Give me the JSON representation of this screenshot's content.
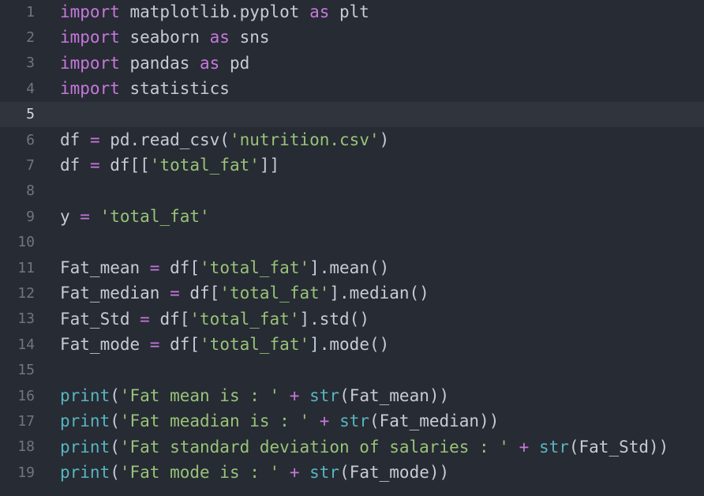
{
  "colors": {
    "background": "#272b33",
    "active_line": "#2f343d",
    "gutter_text": "#6f7683",
    "keyword": "#c678dd",
    "builtin": "#56b6c2",
    "string": "#98c379",
    "text": "#c6ccd7"
  },
  "editor": {
    "active_line": 5,
    "lines": [
      {
        "num": "1",
        "tokens": [
          [
            "kw",
            "import"
          ],
          [
            "txt",
            " matplotlib.pyplot "
          ],
          [
            "kw",
            "as"
          ],
          [
            "txt",
            " plt"
          ]
        ]
      },
      {
        "num": "2",
        "tokens": [
          [
            "kw",
            "import"
          ],
          [
            "txt",
            " seaborn "
          ],
          [
            "kw",
            "as"
          ],
          [
            "txt",
            " sns"
          ]
        ]
      },
      {
        "num": "3",
        "tokens": [
          [
            "kw",
            "import"
          ],
          [
            "txt",
            " pandas "
          ],
          [
            "kw",
            "as"
          ],
          [
            "txt",
            " pd"
          ]
        ]
      },
      {
        "num": "4",
        "tokens": [
          [
            "kw",
            "import"
          ],
          [
            "txt",
            " statistics"
          ]
        ]
      },
      {
        "num": "5",
        "tokens": []
      },
      {
        "num": "6",
        "tokens": [
          [
            "txt",
            "df "
          ],
          [
            "op",
            "="
          ],
          [
            "txt",
            " pd.read_csv("
          ],
          [
            "str",
            "'nutrition.csv'"
          ],
          [
            "txt",
            ")"
          ]
        ]
      },
      {
        "num": "7",
        "tokens": [
          [
            "txt",
            "df "
          ],
          [
            "op",
            "="
          ],
          [
            "txt",
            " df[["
          ],
          [
            "str",
            "'total_fat'"
          ],
          [
            "txt",
            "]]"
          ]
        ]
      },
      {
        "num": "8",
        "tokens": []
      },
      {
        "num": "9",
        "tokens": [
          [
            "txt",
            "y "
          ],
          [
            "op",
            "="
          ],
          [
            "txt",
            " "
          ],
          [
            "str",
            "'total_fat'"
          ]
        ]
      },
      {
        "num": "10",
        "tokens": []
      },
      {
        "num": "11",
        "tokens": [
          [
            "txt",
            "Fat_mean "
          ],
          [
            "op",
            "="
          ],
          [
            "txt",
            " df["
          ],
          [
            "str",
            "'total_fat'"
          ],
          [
            "txt",
            "].mean()"
          ]
        ]
      },
      {
        "num": "12",
        "tokens": [
          [
            "txt",
            "Fat_median "
          ],
          [
            "op",
            "="
          ],
          [
            "txt",
            " df["
          ],
          [
            "str",
            "'total_fat'"
          ],
          [
            "txt",
            "].median()"
          ]
        ]
      },
      {
        "num": "13",
        "tokens": [
          [
            "txt",
            "Fat_Std "
          ],
          [
            "op",
            "="
          ],
          [
            "txt",
            " df["
          ],
          [
            "str",
            "'total_fat'"
          ],
          [
            "txt",
            "].std()"
          ]
        ]
      },
      {
        "num": "14",
        "tokens": [
          [
            "txt",
            "Fat_mode "
          ],
          [
            "op",
            "="
          ],
          [
            "txt",
            " df["
          ],
          [
            "str",
            "'total_fat'"
          ],
          [
            "txt",
            "].mode()"
          ]
        ]
      },
      {
        "num": "15",
        "tokens": []
      },
      {
        "num": "16",
        "tokens": [
          [
            "fn",
            "print"
          ],
          [
            "txt",
            "("
          ],
          [
            "str",
            "'Fat mean is : '"
          ],
          [
            "txt",
            " "
          ],
          [
            "op",
            "+"
          ],
          [
            "txt",
            " "
          ],
          [
            "fn",
            "str"
          ],
          [
            "txt",
            "(Fat_mean))"
          ]
        ]
      },
      {
        "num": "17",
        "tokens": [
          [
            "fn",
            "print"
          ],
          [
            "txt",
            "("
          ],
          [
            "str",
            "'Fat meadian is : '"
          ],
          [
            "txt",
            " "
          ],
          [
            "op",
            "+"
          ],
          [
            "txt",
            " "
          ],
          [
            "fn",
            "str"
          ],
          [
            "txt",
            "(Fat_median))"
          ]
        ]
      },
      {
        "num": "18",
        "tokens": [
          [
            "fn",
            "print"
          ],
          [
            "txt",
            "("
          ],
          [
            "str",
            "'Fat standard deviation of salaries : '"
          ],
          [
            "txt",
            " "
          ],
          [
            "op",
            "+"
          ],
          [
            "txt",
            " "
          ],
          [
            "fn",
            "str"
          ],
          [
            "txt",
            "(Fat_Std))"
          ]
        ]
      },
      {
        "num": "19",
        "tokens": [
          [
            "fn",
            "print"
          ],
          [
            "txt",
            "("
          ],
          [
            "str",
            "'Fat mode is : '"
          ],
          [
            "txt",
            " "
          ],
          [
            "op",
            "+"
          ],
          [
            "txt",
            " "
          ],
          [
            "fn",
            "str"
          ],
          [
            "txt",
            "(Fat_mode))"
          ]
        ]
      }
    ]
  }
}
